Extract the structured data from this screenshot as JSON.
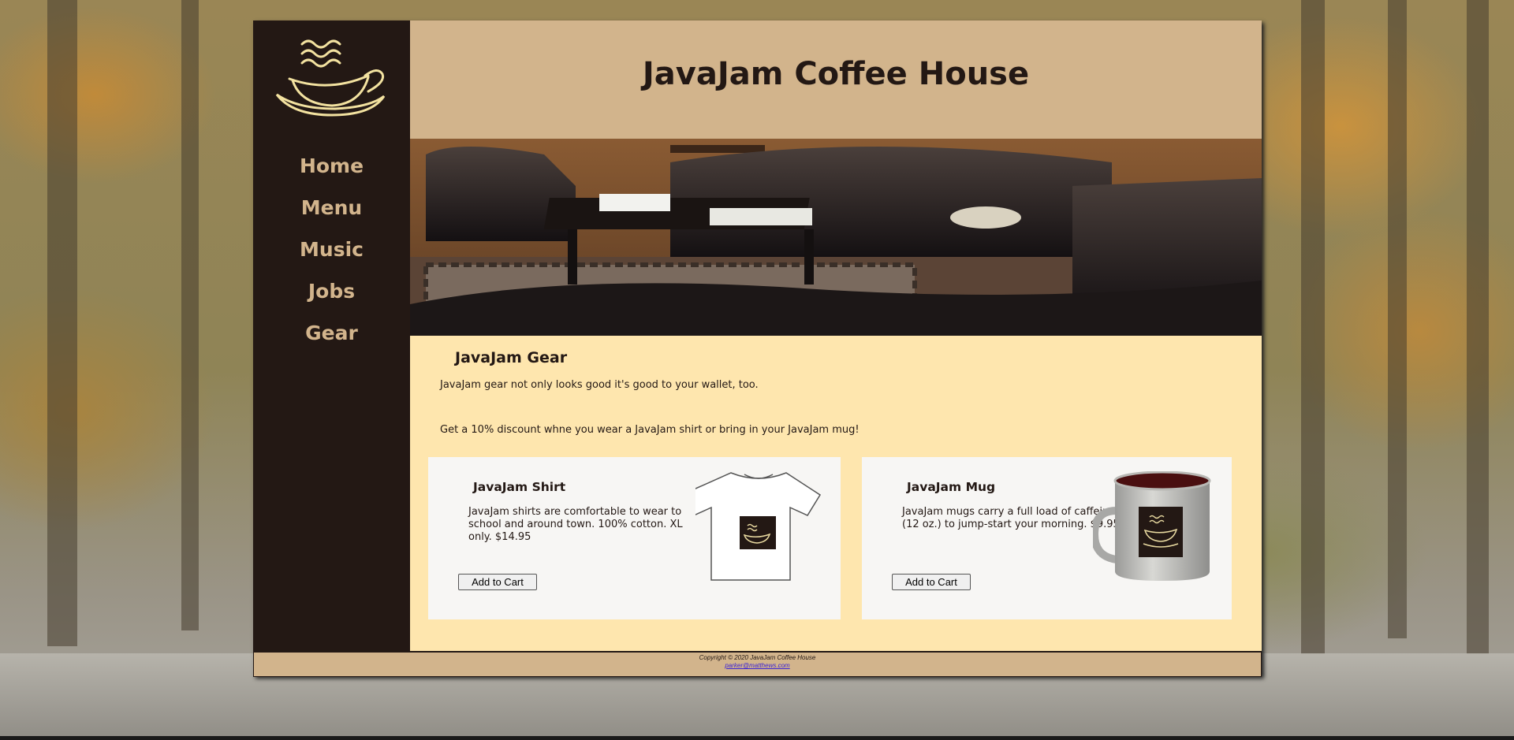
{
  "site": {
    "title": "JavaJam Coffee House"
  },
  "nav": {
    "items": [
      {
        "label": "Home"
      },
      {
        "label": "Menu"
      },
      {
        "label": "Music"
      },
      {
        "label": "Jobs"
      },
      {
        "label": "Gear"
      }
    ]
  },
  "main": {
    "heading": "JavaJam Gear",
    "intro1": "JavaJam gear not only looks good it's good to your wallet, too.",
    "intro2": "Get a 10% discount whne you wear a JavaJam shirt or bring in your JavaJam mug!",
    "products": [
      {
        "name": "JavaJam Shirt",
        "description": "JavaJam shirts are comfortable to wear to school and around town. 100% cotton. XL only. $14.95",
        "button": "Add to Cart",
        "image_icon": "tshirt-icon"
      },
      {
        "name": "JavaJam Mug",
        "description": "JavaJam mugs carry a full load of caffeine (12 oz.) to jump-start your morning. $9.95",
        "button": "Add to Cart",
        "image_icon": "mug-icon"
      }
    ]
  },
  "footer": {
    "copyright": "Copyright © 2020 JavaJam Coffee House",
    "email": "parker@matthews.com"
  },
  "colors": {
    "dark": "#231814",
    "tan": "#d2b48c",
    "cream": "#fee6ae",
    "card": "#f7f6f4",
    "link": "#3a22d6"
  }
}
